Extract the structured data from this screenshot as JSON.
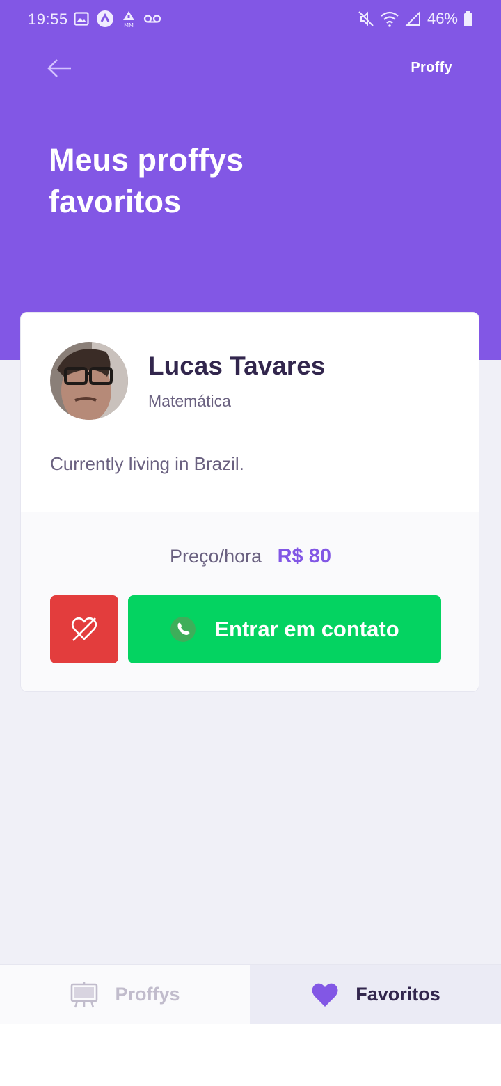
{
  "status_bar": {
    "time": "19:55",
    "battery": "46%"
  },
  "header": {
    "logo": "Proffy",
    "title": "Meus proffys favoritos"
  },
  "teacher": {
    "name": "Lucas Tavares",
    "subject": "Matemática",
    "bio": "Currently living in Brazil.",
    "price_label": "Preço/hora",
    "price_value": "R$ 80",
    "contact_label": "Entrar em contato"
  },
  "tabs": {
    "proffys": "Proffys",
    "favoritos": "Favoritos"
  },
  "colors": {
    "primary": "#8257E5",
    "danger": "#E33D3D",
    "whatsapp": "#04D361",
    "background": "#F0F0F7",
    "title_text": "#32264D",
    "body_text": "#6A6180"
  }
}
